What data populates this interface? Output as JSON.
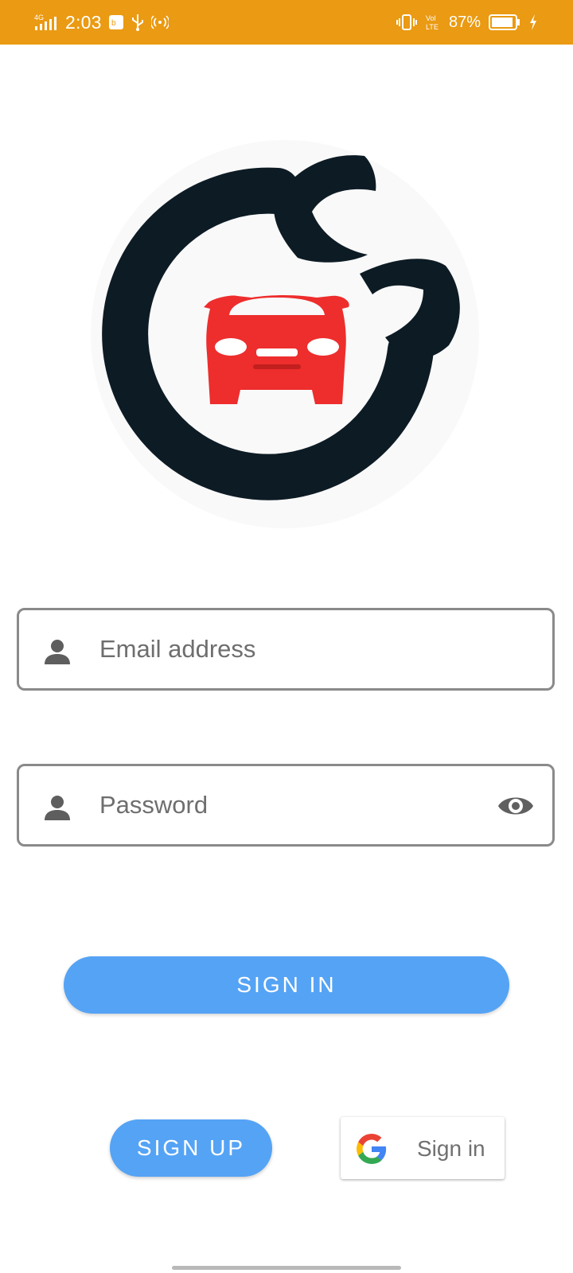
{
  "status_bar": {
    "network": "4G",
    "time": "2:03",
    "volte": "Vol LTE",
    "battery": "87%",
    "color": "#EA9A13"
  },
  "logo": {
    "ring_color": "#0D1B24",
    "car_color": "#EE2D2D"
  },
  "form": {
    "email_placeholder": "Email address",
    "password_placeholder": "Password"
  },
  "buttons": {
    "sign_in": "SIGN IN",
    "sign_up": "SIGN UP",
    "google_sign_in": "Sign in",
    "accent": "#55A3F5"
  },
  "icons": {
    "email": "person-icon",
    "password": "person-icon",
    "visibility": "eye-icon",
    "google": "google-g-icon"
  }
}
